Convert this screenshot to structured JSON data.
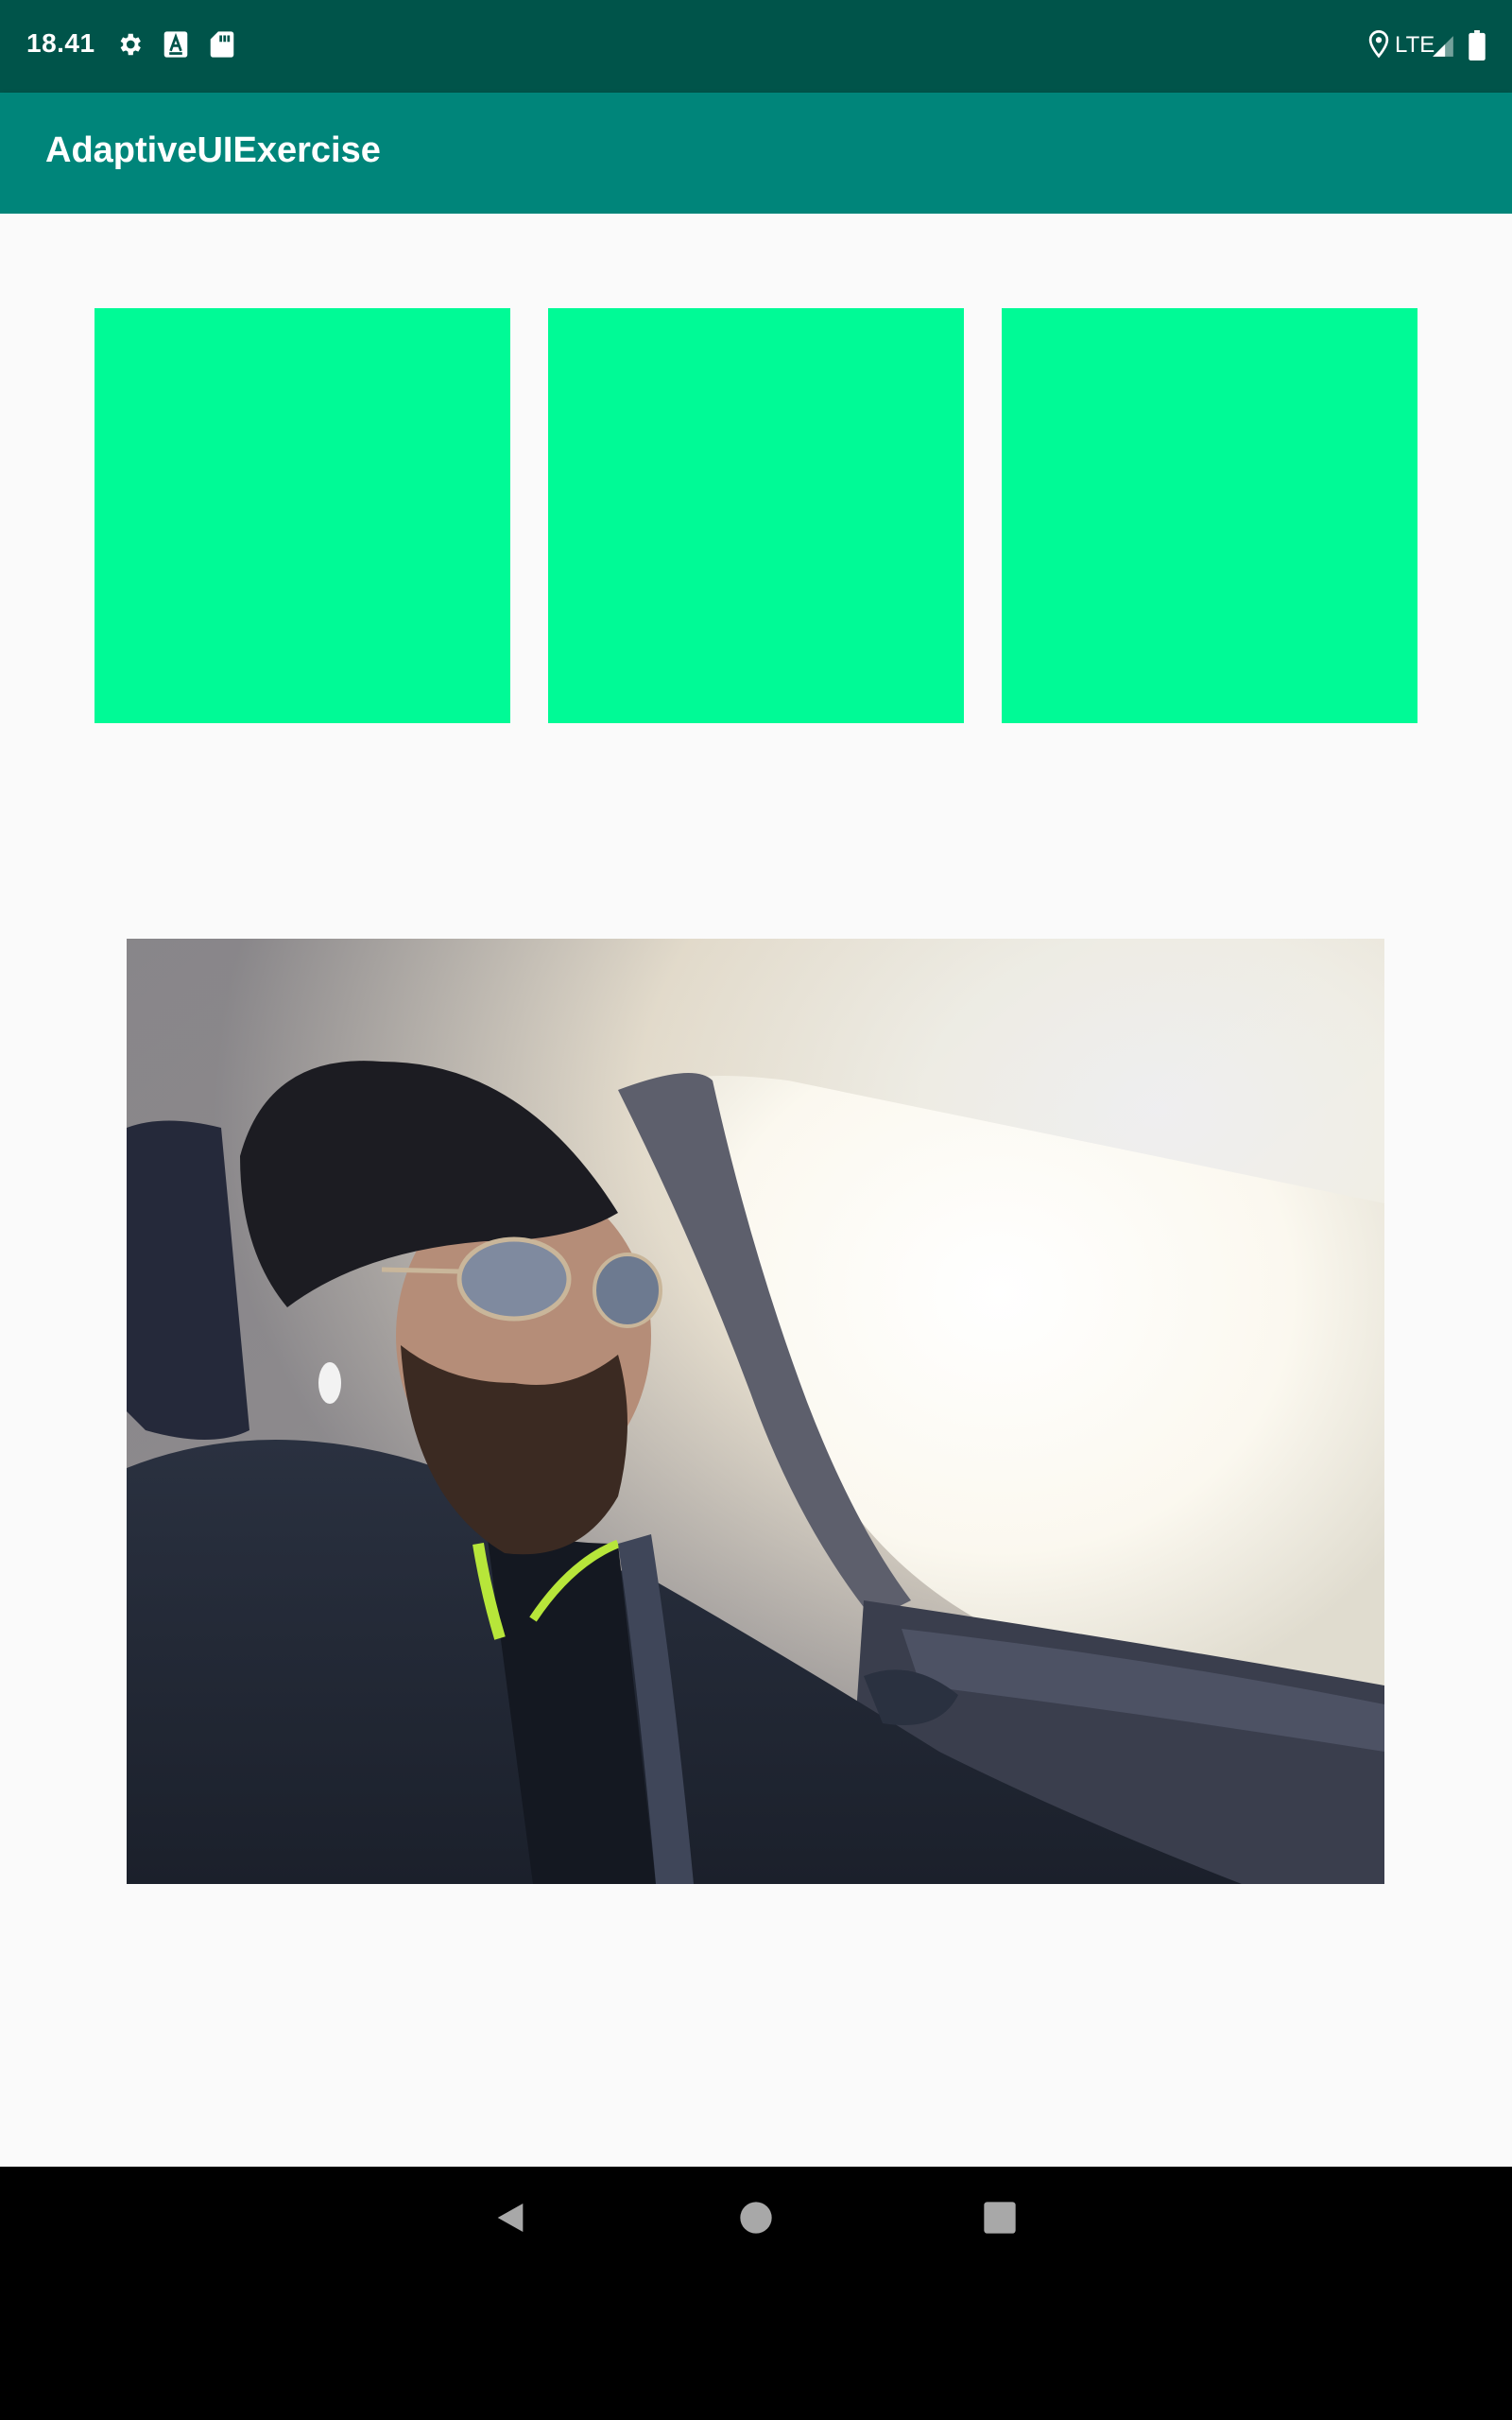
{
  "status_bar": {
    "time": "18.41",
    "network_label": "LTE",
    "icons": [
      "settings-icon",
      "font-icon",
      "sd-card-icon",
      "location-icon",
      "signal-icon",
      "battery-icon"
    ],
    "background": "#00544a"
  },
  "app_bar": {
    "title": "AdaptiveUIExercise",
    "background": "#00857a"
  },
  "boxes": {
    "color": "#00fa96",
    "count": 3
  },
  "photo": {
    "subject": "photo-of-man-driving-car"
  },
  "nav_bar": {
    "icons": [
      "back-icon",
      "home-icon",
      "recents-icon"
    ],
    "background": "#000000"
  }
}
